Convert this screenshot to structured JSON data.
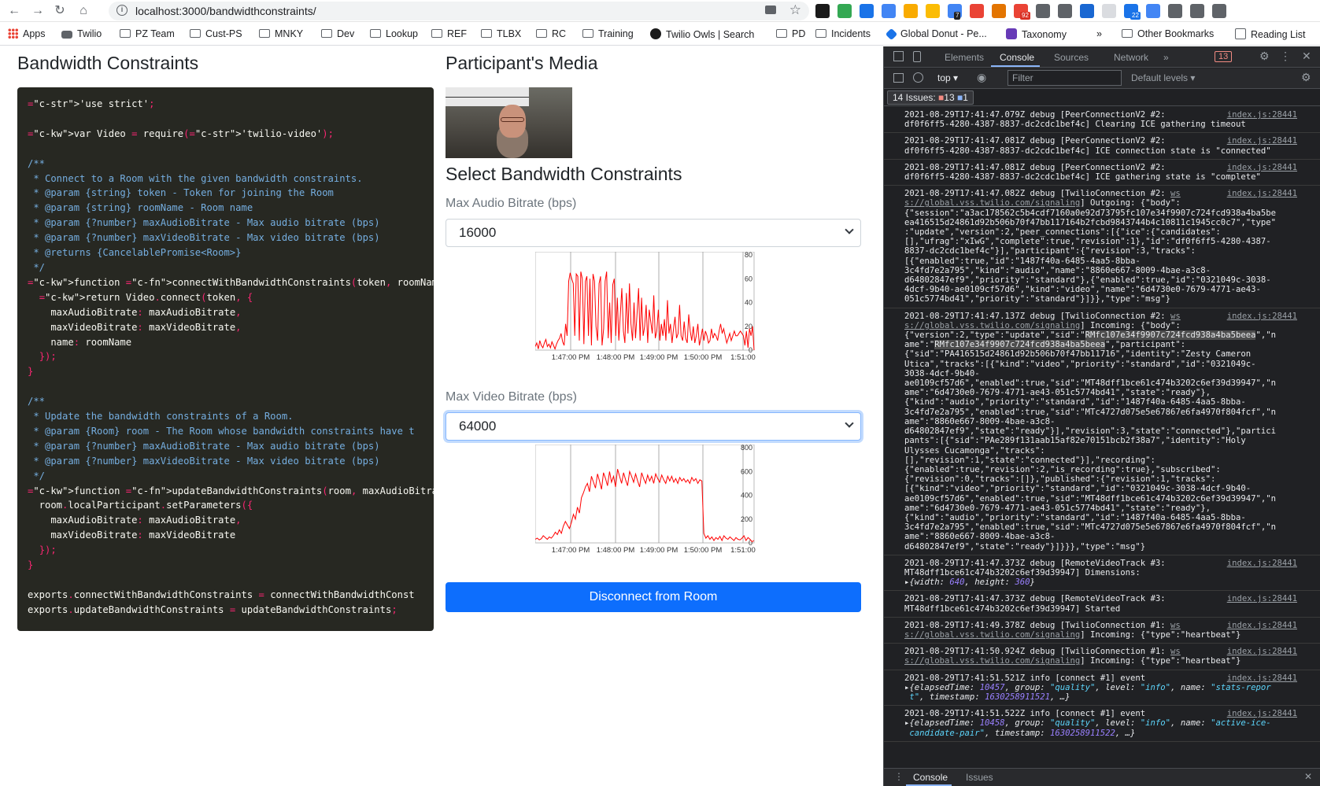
{
  "browser": {
    "url": "localhost:3000/bandwidthconstraints/",
    "bookmarks": [
      "Apps",
      "Twilio",
      "PZ Team",
      "Cust-PS",
      "MNKY",
      "Dev",
      "Lookup",
      "REF",
      "TLBX",
      "RC",
      "Training",
      "Twilio Owls | Search",
      "PD",
      "Incidents",
      "Global Donut - Pe...",
      "Taxonomy",
      "»",
      "Other Bookmarks",
      "Reading List"
    ],
    "ext_badges": [
      "7",
      "92",
      "22"
    ]
  },
  "page": {
    "left_title": "Bandwidth Constraints",
    "right_title": "Participant's Media",
    "select_title": "Select Bandwidth Constraints",
    "audio_label": "Max Audio Bitrate (bps)",
    "audio_value": "16000",
    "video_label": "Max Video Bitrate (bps)",
    "video_value": "64000",
    "disconnect_label": "Disconnect from Room",
    "code_lines": [
      "'use strict';",
      "",
      "var Video = require('twilio-video');",
      "",
      "/**",
      " * Connect to a Room with the given bandwidth constraints.",
      " * @param {string} token - Token for joining the Room",
      " * @param {string} roomName - Room name",
      " * @param {?number} maxAudioBitrate - Max audio bitrate (bps)",
      " * @param {?number} maxVideoBitrate - Max video bitrate (bps)",
      " * @returns {CancelablePromise<Room>}",
      " */",
      "function connectWithBandwidthConstraints(token, roomName, maxAudioB",
      "  return Video.connect(token, {",
      "    maxAudioBitrate: maxAudioBitrate,",
      "    maxVideoBitrate: maxVideoBitrate,",
      "    name: roomName",
      "  });",
      "}",
      "",
      "/**",
      " * Update the bandwidth constraints of a Room.",
      " * @param {Room} room - The Room whose bandwidth constraints have t",
      " * @param {?number} maxAudioBitrate - Max audio bitrate (bps)",
      " * @param {?number} maxVideoBitrate - Max video bitrate (bps)",
      " */",
      "function updateBandwidthConstraints(room, maxAudioBitrate, maxVideo",
      "  room.localParticipant.setParameters({",
      "    maxAudioBitrate: maxAudioBitrate,",
      "    maxVideoBitrate: maxVideoBitrate",
      "  });",
      "}",
      "",
      "exports.connectWithBandwidthConstraints = connectWithBandwidthConst",
      "exports.updateBandwidthConstraints = updateBandwidthConstraints;"
    ]
  },
  "chart_data": [
    {
      "type": "line",
      "title": "",
      "x_ticks": [
        "1:47:00 PM",
        "1:48:00 PM",
        "1:49:00 PM",
        "1:50:00 PM",
        "1:51:00"
      ],
      "y_ticks": [
        0,
        20,
        40,
        60,
        80
      ],
      "ylim": [
        0,
        80
      ],
      "color": "#ff0000",
      "series": [
        {
          "values": [
            3,
            6,
            1,
            8,
            4,
            2,
            6,
            9,
            3,
            5,
            2,
            7,
            4,
            1,
            5,
            8,
            10,
            14,
            7,
            4,
            22,
            12,
            58,
            65,
            60,
            56,
            12,
            64,
            62,
            8,
            66,
            60,
            5,
            58,
            62,
            12,
            60,
            4,
            64,
            58,
            20,
            8,
            56,
            62,
            4,
            18,
            58,
            66,
            10,
            40,
            6,
            55,
            60,
            12,
            44,
            8,
            30,
            52,
            16,
            6,
            48,
            14,
            56,
            22,
            8,
            40,
            10,
            30,
            52,
            8,
            44,
            12,
            20,
            38,
            6,
            34,
            24,
            14,
            46,
            10,
            16,
            34,
            8,
            22,
            12,
            26,
            8,
            42,
            14,
            22,
            6,
            18,
            28,
            10,
            14,
            38,
            12,
            8,
            24,
            10,
            6,
            30,
            16,
            8,
            20,
            6,
            12,
            22,
            4,
            10,
            18,
            8,
            16,
            12,
            6,
            8,
            18,
            10,
            14,
            12,
            8,
            16,
            22,
            14,
            18,
            12,
            6,
            10,
            14,
            8,
            12,
            16,
            12,
            12,
            14,
            16,
            14,
            12,
            4,
            16,
            2,
            18,
            12,
            20,
            0
          ]
        }
      ]
    },
    {
      "type": "line",
      "title": "",
      "x_ticks": [
        "1:47:00 PM",
        "1:48:00 PM",
        "1:49:00 PM",
        "1:50:00 PM",
        "1:51:00"
      ],
      "y_ticks": [
        0,
        200,
        400,
        600,
        800
      ],
      "ylim": [
        0,
        800
      ],
      "color": "#ff0000",
      "series": [
        {
          "values": [
            30,
            40,
            25,
            35,
            60,
            45,
            30,
            50,
            40,
            60,
            90,
            70,
            110,
            80,
            140,
            180,
            150,
            120,
            170,
            240,
            200,
            300,
            250,
            380,
            420,
            470,
            500,
            430,
            560,
            510,
            460,
            580,
            520,
            450,
            590,
            540,
            480,
            600,
            510,
            560,
            470,
            620,
            560,
            500,
            590,
            530,
            480,
            600,
            560,
            510,
            580,
            520,
            470,
            590,
            540,
            500,
            570,
            520,
            560,
            500,
            580,
            540,
            510,
            570,
            530,
            500,
            560,
            520,
            560,
            510,
            540,
            500,
            550,
            520,
            540,
            510,
            530,
            500,
            550,
            520,
            540,
            500,
            530,
            520,
            80,
            40,
            60,
            30,
            50,
            20,
            45,
            30,
            55,
            20,
            60,
            40,
            30,
            50,
            35,
            20,
            45,
            30,
            25,
            40,
            60,
            20,
            45,
            30,
            10,
            20
          ]
        }
      ]
    }
  ],
  "devtools": {
    "tabs": [
      "Elements",
      "Console",
      "Sources",
      "Network",
      "»"
    ],
    "active_tab": "Console",
    "error_count": "13",
    "context": "top",
    "filter_placeholder": "Filter",
    "levels": "Default levels",
    "issues_text": "14 Issues:",
    "issues_errors": "13",
    "issues_info": "1",
    "drawer_tabs": [
      "Console",
      "Issues"
    ],
    "messages": [
      {
        "lines": [
          "2021-08-29T17:41:47.079Z debug [PeerConnectionV2 #2:",
          "df0f6ff5-4280-4387-8837-dc2cdc1bef4c] Clearing ICE gathering timeout"
        ],
        "src": "index.js:28441"
      },
      {
        "lines": [
          "2021-08-29T17:41:47.081Z debug [PeerConnectionV2 #2:",
          "df0f6ff5-4280-4387-8837-dc2cdc1bef4c] ICE connection state is \"connected\""
        ],
        "src": "index.js:28441"
      },
      {
        "lines": [
          "2021-08-29T17:41:47.081Z debug [PeerConnectionV2 #2:",
          "df0f6ff5-4280-4387-8837-dc2cdc1bef4c] ICE gathering state is \"complete\""
        ],
        "src": "index.js:28441"
      },
      {
        "lines": [
          "2021-08-29T17:41:47.082Z debug [TwilioConnection #2: ws",
          "s://global.vss.twilio.com/signaling] Outgoing: {\"body\":",
          "{\"session\":\"a3ac178562c5b4cdf7160a0e92d73795fc107e34f9907c724fcd938a4ba5be",
          "ea416515d24861d92b506b70f47bb117164b2fcbd9843744b4c10811c1945cc0c7\",\"type\"",
          ":\"update\",\"version\":2,\"peer_connections\":[{\"ice\":{\"candidates\":",
          "[],\"ufrag\":\"xIwG\",\"complete\":true,\"revision\":1},\"id\":\"df0f6ff5-4280-4387-",
          "8837-dc2cdc1bef4c\"}],\"participant\":{\"revision\":3,\"tracks\":",
          "[{\"enabled\":true,\"id\":\"1487f40a-6485-4aa5-8bba-",
          "3c4fd7e2a795\",\"kind\":\"audio\",\"name\":\"8860e667-8009-4bae-a3c8-",
          "d64802847ef9\",\"priority\":\"standard\"},{\"enabled\":true,\"id\":\"0321049c-3038-",
          "4dcf-9b40-ae0109cf57d6\",\"kind\":\"video\",\"name\":\"6d4730e0-7679-4771-ae43-",
          "051c5774bd41\",\"priority\":\"standard\"}]}},\"type\":\"msg\"}"
        ],
        "src": "index.js:28441"
      },
      {
        "lines": [
          "2021-08-29T17:41:47.137Z debug [TwilioConnection #2: ws",
          "s://global.vss.twilio.com/signaling] Incoming: {\"body\":",
          "{\"version\":2,\"type\":\"update\",\"sid\":\"RMfc107e34f9907c724fcd938a4ba5beea\",\"n",
          "ame\":\"RMfc107e34f9907c724fcd938a4ba5beea\",\"participant\":",
          "{\"sid\":\"PA416515d24861d92b506b70f47bb11716\",\"identity\":\"Zesty Cameron",
          "Utica\",\"tracks\":[{\"kind\":\"video\",\"priority\":\"standard\",\"id\":\"0321049c-",
          "3038-4dcf-9b40-",
          "ae0109cf57d6\",\"enabled\":true,\"sid\":\"MT48dff1bce61c474b3202c6ef39d39947\",\"n",
          "ame\":\"6d4730e0-7679-4771-ae43-051c5774bd41\",\"state\":\"ready\"},",
          "{\"kind\":\"audio\",\"priority\":\"standard\",\"id\":\"1487f40a-6485-4aa5-8bba-",
          "3c4fd7e2a795\",\"enabled\":true,\"sid\":\"MTc4727d075e5e67867e6fa4970f804fcf\",\"n",
          "ame\":\"8860e667-8009-4bae-a3c8-",
          "d64802847ef9\",\"state\":\"ready\"}],\"revision\":3,\"state\":\"connected\"},\"partici",
          "pants\":[{\"sid\":\"PAe289f131aab15af82e70151bcb2f38a7\",\"identity\":\"Holy",
          "Ulysses Cucamonga\",\"tracks\":",
          "[],\"revision\":1,\"state\":\"connected\"}],\"recording\":",
          "{\"enabled\":true,\"revision\":2,\"is_recording\":true},\"subscribed\":",
          "{\"revision\":0,\"tracks\":[]},\"published\":{\"revision\":1,\"tracks\":",
          "[{\"kind\":\"video\",\"priority\":\"standard\",\"id\":\"0321049c-3038-4dcf-9b40-",
          "ae0109cf57d6\",\"enabled\":true,\"sid\":\"MT48dff1bce61c474b3202c6ef39d39947\",\"n",
          "ame\":\"6d4730e0-7679-4771-ae43-051c5774bd41\",\"state\":\"ready\"},",
          "{\"kind\":\"audio\",\"priority\":\"standard\",\"id\":\"1487f40a-6485-4aa5-8bba-",
          "3c4fd7e2a795\",\"enabled\":true,\"sid\":\"MTc4727d075e5e67867e6fa4970f804fcf\",\"n",
          "ame\":\"8860e667-8009-4bae-a3c8-",
          "d64802847ef9\",\"state\":\"ready\"}]}}},\"type\":\"msg\"}"
        ],
        "src": "index.js:28441"
      },
      {
        "lines": [
          "2021-08-29T17:41:47.373Z debug [RemoteVideoTrack #3:",
          "MT48dff1bce61c474b3202c6ef39d39947] Dimensions:"
        ],
        "obj": "{width: 640, height: 360}",
        "src": "index.js:28441"
      },
      {
        "lines": [
          "2021-08-29T17:41:47.373Z debug [RemoteVideoTrack #3:",
          "MT48dff1bce61c474b3202c6ef39d39947] Started"
        ],
        "src": "index.js:28441"
      },
      {
        "lines": [
          "2021-08-29T17:41:49.378Z debug [TwilioConnection #1: ws",
          "s://global.vss.twilio.com/signaling] Incoming: {\"type\":\"heartbeat\"}"
        ],
        "src": "index.js:28441"
      },
      {
        "lines": [
          "2021-08-29T17:41:50.924Z debug [TwilioConnection #1: ws",
          "s://global.vss.twilio.com/signaling] Incoming: {\"type\":\"heartbeat\"}"
        ],
        "src": "index.js:28441"
      },
      {
        "lines": [
          "2021-08-29T17:41:51.521Z info [connect #1] event"
        ],
        "obj": "{elapsedTime: 10457, group: \"quality\", level: \"info\", name: \"stats-repor",
        "obj2": "t\", timestamp: 1630258911521, …}",
        "src": "index.js:28441"
      },
      {
        "lines": [
          "2021-08-29T17:41:51.522Z info [connect #1] event"
        ],
        "obj": "{elapsedTime: 10458, group: \"quality\", level: \"info\", name: \"active-ice-",
        "obj2": "candidate-pair\", timestamp: 1630258911522, …}",
        "src": "index.js:28441"
      }
    ]
  }
}
